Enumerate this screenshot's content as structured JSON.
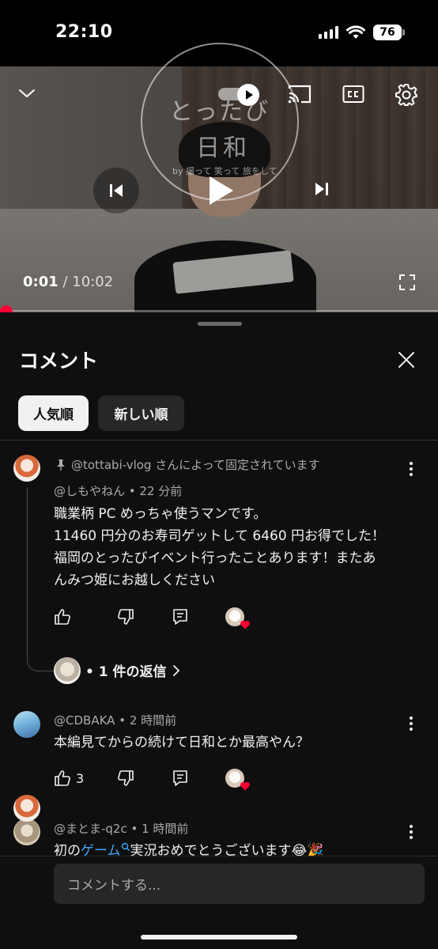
{
  "status_bar": {
    "time": "22:10",
    "battery": "76"
  },
  "player": {
    "overlay_logo": {
      "line1": "とったび",
      "line2": "日和",
      "tagline": "by 撮って 笑って 旅をして"
    },
    "current_time": "0:01",
    "separator": " / ",
    "duration": "10:02",
    "progress_fraction": 0.002
  },
  "comments_panel": {
    "title": "コメント",
    "sort_chips": [
      {
        "label": "人気順",
        "selected": true
      },
      {
        "label": "新しい順",
        "selected": false
      }
    ],
    "comments": [
      {
        "pinned_label": "@tottabi-vlog さんによって固定されています",
        "author": "@しもやねん",
        "time": "22 分前",
        "lines": [
          "職業柄 PC めっちゃ使うマンです。",
          "11460 円分のお寿司ゲットして 6460 円お得でした！",
          "福岡のとったびイベント行ったことあります！またあ",
          "んみつ姫にお越しください"
        ],
        "likes": "",
        "replies_label": "• 1 件の返信"
      },
      {
        "author": "@CDBAKA",
        "time": "2 時間前",
        "lines": [
          "本編見てからの続けて日和とか最高やん？"
        ],
        "likes": "3"
      },
      {
        "author": "@まとま-q2c",
        "time": "1 時間前",
        "text_prefix": "初の",
        "link_text": "ゲーム",
        "text_suffix": "実況おめでとうございます😂🎉"
      }
    ],
    "composer_placeholder": "コメントする..."
  },
  "colors": {
    "accent_red": "#ff0033",
    "link_blue": "#3ea6ff",
    "background": "#0f0f0f"
  },
  "icons": [
    "chevron-down-icon",
    "autoplay-toggle",
    "cast-icon",
    "cc-icon",
    "gear-icon",
    "previous-icon",
    "play-icon",
    "next-icon",
    "fullscreen-icon",
    "close-icon",
    "pin-icon",
    "more-vert-icon",
    "thumb-up-icon",
    "thumb-down-icon",
    "reply-icon",
    "heart-icon",
    "chevron-right-icon",
    "search-icon"
  ]
}
